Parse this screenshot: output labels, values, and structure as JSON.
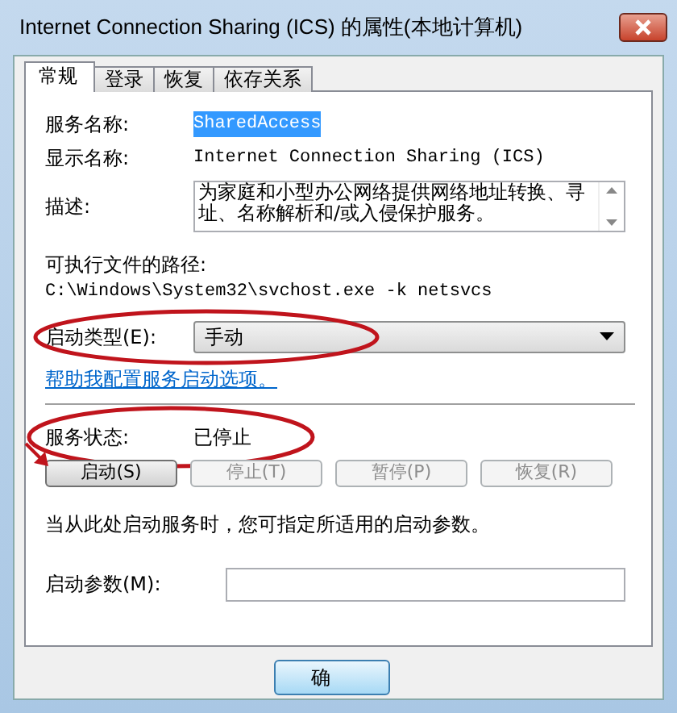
{
  "window": {
    "title": "Internet Connection Sharing (ICS) 的属性(本地计算机)"
  },
  "tabs": [
    {
      "label": "常规",
      "selected": true
    },
    {
      "label": "登录",
      "selected": false
    },
    {
      "label": "恢复",
      "selected": false
    },
    {
      "label": "依存关系",
      "selected": false
    }
  ],
  "service_name": {
    "label": "服务名称:",
    "value": "SharedAccess",
    "selected": true
  },
  "display_name": {
    "label": "显示名称:",
    "value": "Internet Connection Sharing (ICS)"
  },
  "description": {
    "label": "描述:",
    "value": "为家庭和小型办公网络提供网络地址转换、寻址、名称解析和/或入侵保护服务。"
  },
  "executable_path": {
    "label": "可执行文件的路径:",
    "value": "C:\\Windows\\System32\\svchost.exe -k netsvcs"
  },
  "startup_type": {
    "label": "启动类型(E):",
    "value": "手动",
    "highlighted": true
  },
  "help_link": "帮助我配置服务启动选项。",
  "service_status": {
    "label": "服务状态:",
    "value": "已停止",
    "highlighted": true
  },
  "buttons": [
    {
      "label": "启动(S)",
      "disabled": false,
      "highlighted": true
    },
    {
      "label": "停止(T)",
      "disabled": true,
      "highlighted": false
    },
    {
      "label": "暂停(P)",
      "disabled": true,
      "highlighted": false
    },
    {
      "label": "恢复(R)",
      "disabled": true,
      "highlighted": false
    }
  ],
  "hint": "当从此处启动服务时，您可指定所适用的启动参数。",
  "start_parameters": {
    "label": "启动参数(M):"
  },
  "footer_buttons": [
    {
      "label": "确"
    }
  ]
}
